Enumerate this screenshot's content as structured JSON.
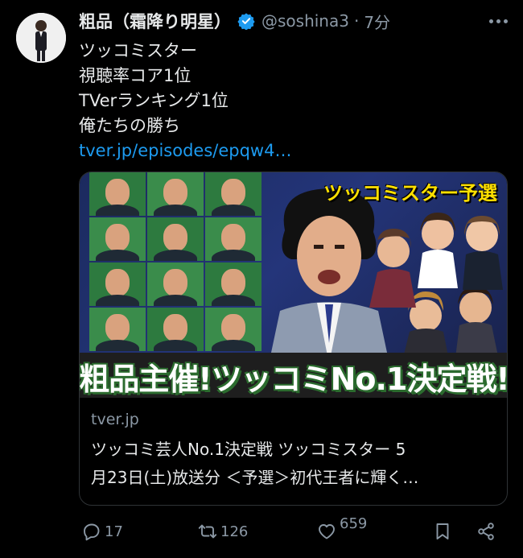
{
  "tweet": {
    "display_name": "粗品（霜降り明星）",
    "handle": "@soshina3",
    "separator": "·",
    "time": "7分",
    "lines": [
      "ツッコミスター",
      "視聴率コア1位",
      "TVerランキング1位",
      "俺たちの勝ち"
    ],
    "link_text": "tver.jp/episodes/epqw4…"
  },
  "card": {
    "thumbnail_banner": "ツッコミスター予選",
    "thumbnail_caption": "粗品主催!ツッコミNo.1決定戦!",
    "domain": "tver.jp",
    "title_line1": "ツッコミ芸人No.1決定戦 ツッコミスター 5",
    "title_line2": "月23日(土)放送分 ＜予選＞初代王者に輝く…"
  },
  "actions": {
    "reply_count": "17",
    "retweet_count": "126",
    "like_count": "659"
  },
  "colors": {
    "background": "#000000",
    "text": "#e7e9ea",
    "muted": "#8b98a5",
    "link": "#1d9bf0",
    "verified": "#1d9bf0"
  },
  "icons": [
    "verified-badge-icon",
    "more-icon",
    "reply-icon",
    "retweet-icon",
    "like-icon",
    "bookmark-icon",
    "share-icon"
  ]
}
